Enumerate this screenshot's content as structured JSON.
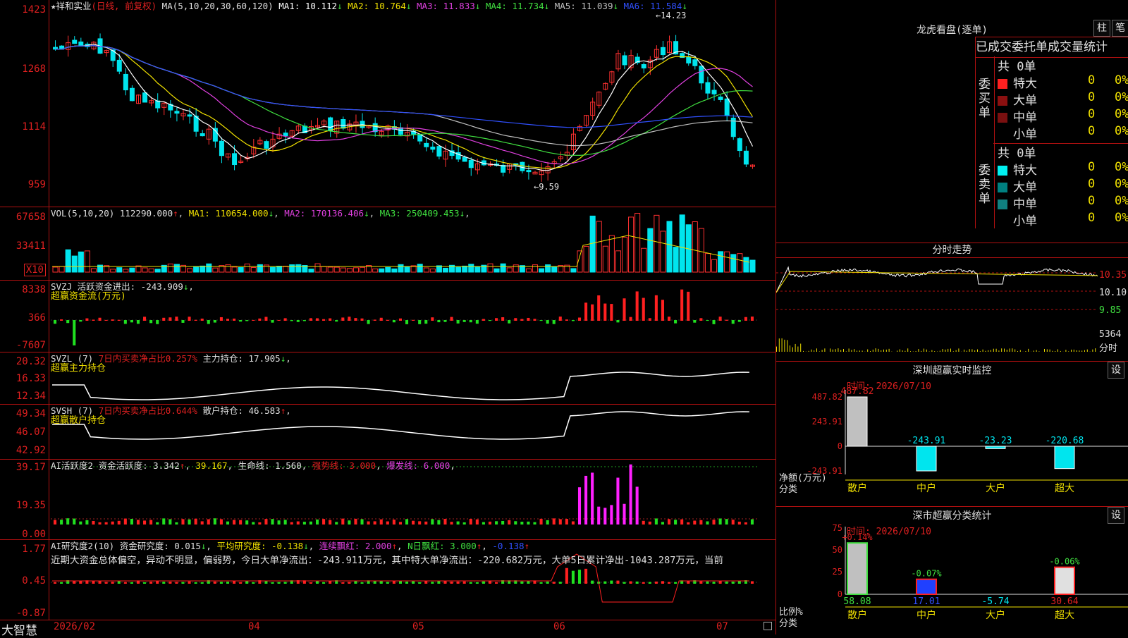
{
  "stock": {
    "name": "★祥和实业",
    "mode": "(日线, 前复权)",
    "ma_params": "MA(5,10,20,30,60,120)",
    "ma": [
      {
        "label": "MA1: 10.112",
        "arrow": "↓",
        "color": "#ffffff"
      },
      {
        "label": "MA2: 10.764",
        "arrow": "↓",
        "color": "#f0e000"
      },
      {
        "label": "MA3: 11.833",
        "arrow": "↓",
        "color": "#e040e0"
      },
      {
        "label": "MA4: 11.734",
        "arrow": "↓",
        "color": "#40e040"
      },
      {
        "label": "MA5: 11.039",
        "arrow": "↓",
        "color": "#c0c0c0"
      },
      {
        "label": "MA6: 11.584",
        "arrow": "↓",
        "color": "#3050ff"
      }
    ],
    "high_mark": "14.23",
    "low_mark": "9.59"
  },
  "price_axis": [
    "1423",
    "1268",
    "1114",
    "959"
  ],
  "vol": {
    "label": "VOL(5,10,20)",
    "value": "112290.000",
    "ma": [
      {
        "label": "MA1: 110654.000",
        "arrow": "↓",
        "color": "#f0e000"
      },
      {
        "label": "MA2: 170136.406",
        "arrow": "↓",
        "color": "#e040e0"
      },
      {
        "label": "MA3: 250409.453",
        "arrow": "↓",
        "color": "#40e040"
      }
    ],
    "axis": [
      "67658",
      "33411",
      "X10"
    ]
  },
  "svzj": {
    "label": "SVZJ  活跃资金进出: -243.909",
    "arrow": "↓",
    "caption": "超赢资金流(万元)",
    "axis": [
      "8338",
      "366",
      "-7607"
    ]
  },
  "svzl": {
    "label": "SVZL  (7)",
    "ratio": "7日内买卖净占比0.257%",
    "hold": "主力持仓: 17.905",
    "arrow": "↓",
    "caption": "超赢主力持仓",
    "axis": [
      "20.32",
      "16.33",
      "12.34"
    ]
  },
  "svsh": {
    "label": "SVSH  (7)",
    "ratio": "7日内买卖净占比0.644%",
    "hold": "散户持仓: 46.583",
    "arrow": "↑",
    "caption": "超赢散户持仓",
    "axis": [
      "49.34",
      "46.07",
      "42.92"
    ]
  },
  "ai_active": {
    "label": "AI活跃度2  资金活跃度: 3.342",
    "v2": "39.167",
    "life": "生命线: 1.560",
    "strong": "强势线: 3.000",
    "burst": "爆发线: 6.000",
    "axis": [
      "39.17",
      "19.35",
      "0.00"
    ]
  },
  "ai_research": {
    "label": "AI研究度2(10)  资金研究度: 0.015",
    "avg": "平均研究度: -0.138",
    "cont": "连续飘红: 2.000",
    "nday": "N日飘红: 3.000",
    "last": "-0.138",
    "comment": "近期大资金总体偏空，异动不明显，偏弱势，今日大单净流出：-243.911万元，其中特大单净流出：-220.682万元，大单5日累计净出-1043.287万元，当前",
    "axis": [
      "1.77",
      "0.45",
      "-0.87"
    ]
  },
  "bottom": {
    "brand": "大智慧",
    "dates": [
      "2026/02",
      "04",
      "05",
      "06",
      "07"
    ]
  },
  "longhu": {
    "title": "龙虎看盘(逐单)",
    "btn_bar": "柱",
    "btn_pen": "笔",
    "tabs": [
      "已成交",
      "委托单",
      "成交量统计"
    ],
    "buy_side": "委买单",
    "sell_side": "委卖单",
    "buy_total": "共 0单",
    "sell_total": "共 0单",
    "buy_rows": [
      {
        "name": "特大",
        "n": "0",
        "p": "0%",
        "color": "#ff2020"
      },
      {
        "name": "大单",
        "n": "0",
        "p": "0%",
        "color": "#8b1010"
      },
      {
        "name": "中单",
        "n": "0",
        "p": "0%",
        "color": "#7a1010"
      },
      {
        "name": "小单",
        "n": "0",
        "p": "0%",
        "color": "#000000"
      }
    ],
    "sell_rows": [
      {
        "name": "特大",
        "n": "0",
        "p": "0%",
        "color": "#00f0f0"
      },
      {
        "name": "大单",
        "n": "0",
        "p": "0%",
        "color": "#008080"
      },
      {
        "name": "中单",
        "n": "0",
        "p": "0%",
        "color": "#108080"
      },
      {
        "name": "小单",
        "n": "0",
        "p": "0%",
        "color": "#000000"
      }
    ]
  },
  "intraday": {
    "title": "分时走势",
    "axis": [
      "10.35",
      "10.10",
      "9.85",
      "5364",
      "分时"
    ]
  },
  "monitor": {
    "title": "深圳超赢实时监控",
    "btn": "设",
    "time": "时间: 2026/07/10",
    "axis": [
      "487.82",
      "243.91",
      "0",
      "-243.91"
    ],
    "unit": "净额(万元)",
    "cat_label": "分类",
    "bars": [
      {
        "cat": "散户",
        "value": 487.82,
        "label": "487.82"
      },
      {
        "cat": "中户",
        "value": -243.91,
        "label": "-243.91"
      },
      {
        "cat": "大户",
        "value": -23.23,
        "label": "-23.23"
      },
      {
        "cat": "超大",
        "value": -220.68,
        "label": "-220.68"
      }
    ]
  },
  "classify": {
    "title": "深市超赢分类统计",
    "btn": "设",
    "time": "时间: 2026/07/10",
    "axis": [
      "75",
      "50",
      "25",
      "0"
    ],
    "unit": "比例%",
    "cat_label": "分类",
    "bars": [
      {
        "cat": "散户",
        "value": 58.08,
        "label": "58.08",
        "chg": "+0.14%",
        "color": "#c0c0c0"
      },
      {
        "cat": "中户",
        "value": 17.01,
        "label": "17.01",
        "chg": "-0.07%",
        "color": "#2040ff"
      },
      {
        "cat": "大户",
        "value": -5.74,
        "label": "-5.74",
        "chg": "",
        "color": "#00f0f0"
      },
      {
        "cat": "超大",
        "value": 30.64,
        "label": "30.64",
        "chg": "-0.06%",
        "color": "#e0e0e0"
      }
    ]
  }
}
